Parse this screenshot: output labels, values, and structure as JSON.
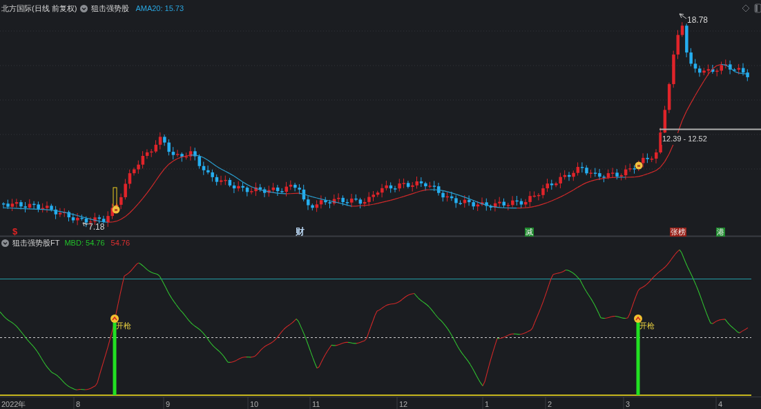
{
  "chart_header": {
    "title": "北方国际(日线 前复权)",
    "indicator": "狙击强势股",
    "ama": "AMA20: 15.73"
  },
  "price_labels": {
    "high": "18.78",
    "low": "7.18",
    "range": "12.39 - 12.52"
  },
  "event_tags": [
    {
      "text": "$",
      "kind": "text",
      "color": "#e02424"
    },
    {
      "text": "财",
      "kind": "text",
      "color": "#b8d4f0"
    },
    {
      "text": "减",
      "kind": "badge",
      "color": "#1f8a2e"
    },
    {
      "text": "张榜",
      "kind": "badge",
      "color": "#9a2018"
    },
    {
      "text": "港",
      "kind": "badge",
      "color": "#1f8a2e"
    }
  ],
  "indicator_panel": {
    "title": "狙击强势股FT",
    "mbd": "MBD: 54.76",
    "value": "54.76",
    "signals": [
      {
        "label": "开枪"
      },
      {
        "label": "开枪"
      }
    ]
  },
  "x_axis": {
    "labels": [
      "2022年",
      "8",
      "9",
      "10",
      "11",
      "12",
      "1",
      "2",
      "3",
      "4"
    ]
  }
}
